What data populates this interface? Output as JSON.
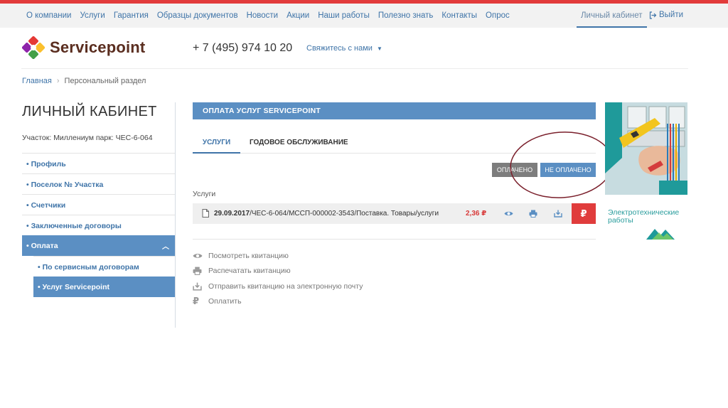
{
  "topnav": {
    "items": [
      "О компании",
      "Услуги",
      "Гарантия",
      "Образцы документов",
      "Новости",
      "Акции",
      "Наши работы",
      "Полезно знать",
      "Контакты",
      "Опрос"
    ],
    "cabinet": "Личный кабинет",
    "logout": "Выйти"
  },
  "header": {
    "logo_text": "Servicepoint",
    "phone": "+ 7 (495) 974 10 20",
    "contact": "Свяжитесь с нами"
  },
  "breadcrumb": {
    "home": "Главная",
    "current": "Персональный раздел"
  },
  "sidebar": {
    "title": "ЛИЧНЫЙ КАБИНЕТ",
    "plot_info": "Участок: Миллениум парк: ЧЕС-6-064",
    "items": [
      "• Профиль",
      "• Поселок № Участка",
      "• Счетчики",
      "• Заключенные договоры",
      "• Оплата"
    ],
    "subitems": [
      "• По сервисным договорам",
      "• Услуг Servicepoint"
    ]
  },
  "main": {
    "section_title": "ОПЛАТА УСЛУГ SERVICEPOINT",
    "tabs": [
      "УСЛУГИ",
      "ГОДОВОЕ ОБСЛУЖИВАНИЕ"
    ],
    "filters": {
      "paid": "ОПЛАЧЕНО",
      "unpaid": "НЕ ОПЛАЧЕНО"
    },
    "services_label": "Услуги",
    "row": {
      "date": "29.09.2017",
      "description": "/ЧЕС-6-064/МССП-000002-3543/Поставка. Товары/услуги",
      "amount": "2,36 ₽"
    },
    "legend": [
      "Посмотреть квитанцию",
      "Распечатать квитанцию",
      "Отправить квитанцию на электронную почту",
      "Оплатить"
    ]
  },
  "banner": {
    "line1": "Электротехнические",
    "line2": "работы"
  },
  "colors": {
    "accent": "#5b8fc3",
    "link": "#3f74a8",
    "top_red": "#e23b3b",
    "pay_red": "#e03c3c",
    "paid_gray": "#7d7d7d",
    "brand_brown": "#5a2d1f",
    "banner_teal": "#2a9d9d"
  }
}
